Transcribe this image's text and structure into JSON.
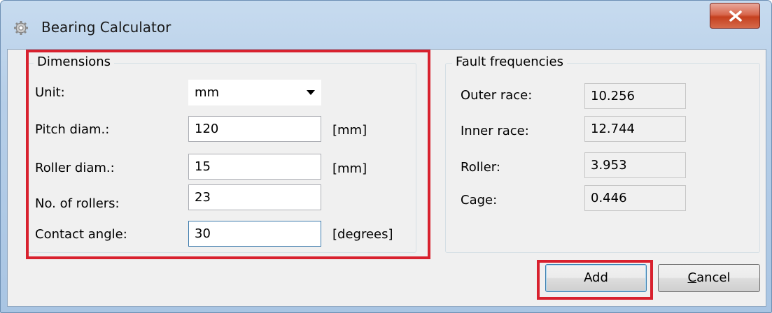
{
  "window": {
    "title": "Bearing Calculator"
  },
  "dimensions": {
    "legend": "Dimensions",
    "unit": {
      "label": "Unit:",
      "value": "mm"
    },
    "pitch": {
      "label": "Pitch diam.:",
      "value": "120",
      "unit": "[mm]"
    },
    "roller": {
      "label": "Roller diam.:",
      "value": "15",
      "unit": "[mm]"
    },
    "rollers": {
      "label": "No. of rollers:",
      "value": "23"
    },
    "angle": {
      "label": "Contact angle:",
      "value": "30",
      "unit": "[degrees]"
    }
  },
  "faults": {
    "legend": "Fault frequencies",
    "outer": {
      "label": "Outer race:",
      "value": "10.256"
    },
    "inner": {
      "label": "Inner race:",
      "value": "12.744"
    },
    "roller": {
      "label": "Roller:",
      "value": "3.953"
    },
    "cage": {
      "label": "Cage:",
      "value": "0.446"
    }
  },
  "buttons": {
    "add": "Add",
    "cancel_prefix": "C",
    "cancel_rest": "ancel"
  },
  "colors": {
    "highlight": "#d8212e",
    "close": "#c5401f"
  },
  "icons": {
    "app": "gear-icon",
    "close": "close-icon",
    "dropdown": "chevron-down-icon"
  }
}
